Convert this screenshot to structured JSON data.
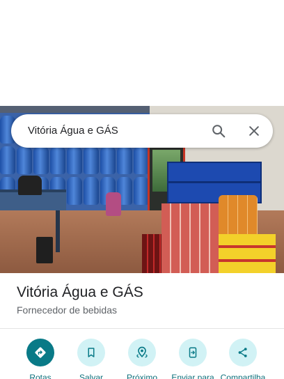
{
  "search": {
    "query": "Vitória Água e GÁS"
  },
  "place": {
    "name": "Vitória Água e GÁS",
    "category": "Fornecedor de bebidas"
  },
  "actions": [
    {
      "label": "Rotas",
      "icon": "directions-icon"
    },
    {
      "label": "Salvar",
      "icon": "bookmark-icon"
    },
    {
      "label": "Próximo",
      "icon": "nearby-icon"
    },
    {
      "label": "Enviar para",
      "icon": "send-to-phone-icon"
    },
    {
      "label": "Compartilha",
      "icon": "share-icon"
    }
  ],
  "colors": {
    "accent": "#097a87",
    "accent_light": "#d1f2f5",
    "label": "#0b6f7b",
    "title": "#202124",
    "secondary": "#5f6368"
  }
}
